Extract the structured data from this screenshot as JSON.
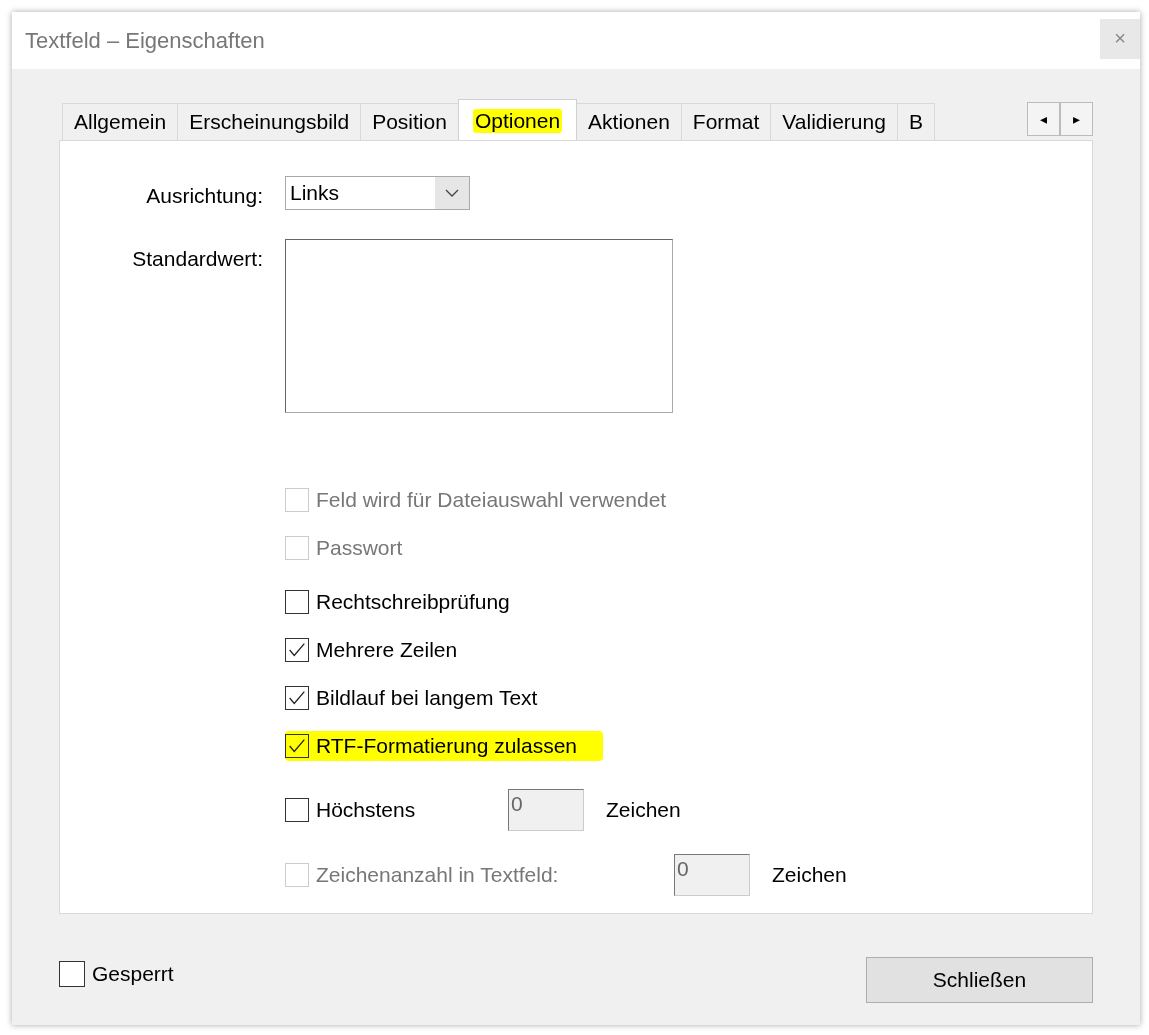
{
  "window": {
    "title": "Textfeld – Eigenschaften",
    "close": "×"
  },
  "tabs": [
    {
      "label": "Allgemein",
      "selected": false,
      "highlighted": false
    },
    {
      "label": "Erscheinungsbild",
      "selected": false,
      "highlighted": false
    },
    {
      "label": "Position",
      "selected": false,
      "highlighted": false
    },
    {
      "label": "Optionen",
      "selected": true,
      "highlighted": true
    },
    {
      "label": "Aktionen",
      "selected": false,
      "highlighted": false
    },
    {
      "label": "Format",
      "selected": false,
      "highlighted": false
    },
    {
      "label": "Validierung",
      "selected": false,
      "highlighted": false
    },
    {
      "label": "B",
      "selected": false,
      "highlighted": false
    }
  ],
  "tab_scroll": {
    "left": "◂",
    "right": "▸"
  },
  "alignment": {
    "label": "Ausrichtung:",
    "value": "Links"
  },
  "default_value": {
    "label": "Standardwert:"
  },
  "options": [
    {
      "kind": "checkbox",
      "label": "Feld wird für Dateiauswahl verwendet",
      "checked": false,
      "disabled": true,
      "highlighted": false
    },
    {
      "kind": "checkbox",
      "label": "Passwort",
      "checked": false,
      "disabled": true,
      "highlighted": false
    },
    {
      "kind": "checkbox",
      "label": "Rechtschreibprüfung",
      "checked": false,
      "disabled": false,
      "highlighted": false
    },
    {
      "kind": "checkbox",
      "label": "Mehrere Zeilen",
      "checked": true,
      "disabled": false,
      "highlighted": false
    },
    {
      "kind": "checkbox",
      "label": "Bildlauf bei langem Text",
      "checked": true,
      "disabled": false,
      "highlighted": false
    },
    {
      "kind": "checkbox",
      "label": "RTF-Formatierung zulassen",
      "checked": true,
      "disabled": false,
      "highlighted": true
    },
    {
      "kind": "count",
      "label": "Höchstens",
      "checked": false,
      "disabled": false,
      "highlighted": false,
      "value": "0",
      "unit": "Zeichen"
    },
    {
      "kind": "count",
      "label": "Zeichenanzahl in Textfeld:",
      "checked": false,
      "disabled": true,
      "highlighted": false,
      "value": "0",
      "unit": "Zeichen"
    }
  ],
  "locked": {
    "label": "Gesperrt",
    "checked": false
  },
  "buttons": [
    {
      "label": "Schließen"
    }
  ]
}
